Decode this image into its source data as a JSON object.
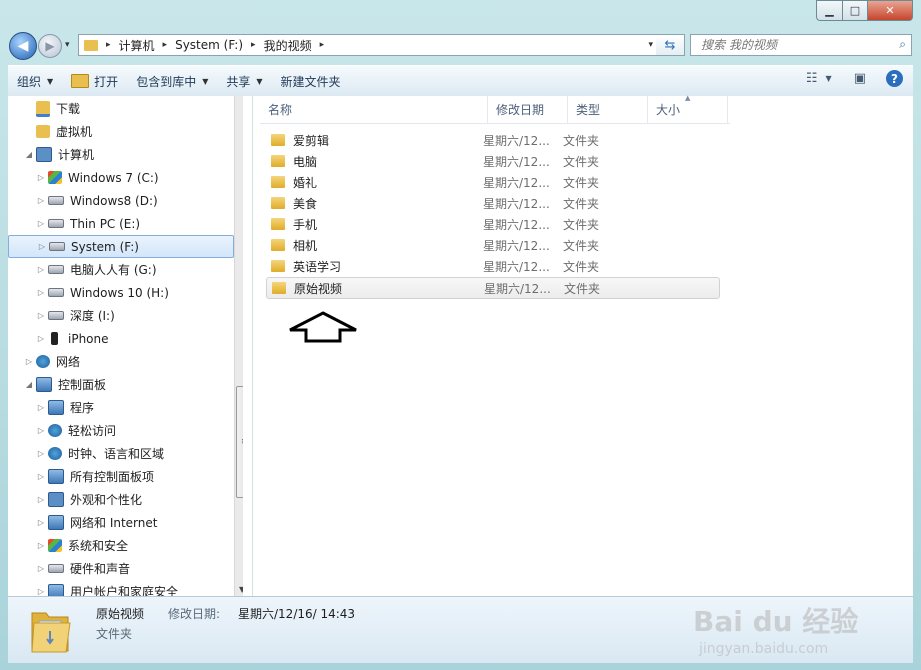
{
  "window": {
    "minimize_symbol": "▁",
    "maximize_symbol": "□",
    "close_symbol": "✕"
  },
  "navigation": {
    "back_symbol": "◀",
    "forward_symbol": "▶",
    "dropdown_symbol": "▾",
    "breadcrumbs": [
      "计算机",
      "System (F:)",
      "我的视频"
    ],
    "refresh_symbol": "⇆"
  },
  "search": {
    "placeholder": "搜索 我的视频"
  },
  "toolbar": {
    "organize": "组织",
    "open": "打开",
    "include_in_library": "包含到库中",
    "share": "共享",
    "new_folder": "新建文件夹",
    "help": "?"
  },
  "tree": {
    "items": [
      {
        "label": "下载",
        "icon": "download-folder-icon"
      },
      {
        "label": "虚拟机",
        "icon": "folder-icon"
      },
      {
        "label": "计算机",
        "icon": "computer-icon"
      },
      {
        "label": "Windows 7  (C:)",
        "icon": "windows-drive-icon"
      },
      {
        "label": "Windows8 (D:)",
        "icon": "drive-icon"
      },
      {
        "label": "Thin PC (E:)",
        "icon": "drive-icon"
      },
      {
        "label": "System (F:)",
        "icon": "drive-icon"
      },
      {
        "label": "电脑人人有 (G:)",
        "icon": "drive-icon"
      },
      {
        "label": "Windows 10 (H:)",
        "icon": "drive-icon"
      },
      {
        "label": "深度 (I:)",
        "icon": "drive-icon"
      },
      {
        "label": "iPhone",
        "icon": "phone-icon"
      },
      {
        "label": "网络",
        "icon": "network-icon"
      },
      {
        "label": "控制面板",
        "icon": "control-panel-icon"
      },
      {
        "label": "程序",
        "icon": "programs-icon"
      },
      {
        "label": "轻松访问",
        "icon": "accessibility-icon"
      },
      {
        "label": "时钟、语言和区域",
        "icon": "clock-language-icon"
      },
      {
        "label": "所有控制面板项",
        "icon": "control-panel-icon"
      },
      {
        "label": "外观和个性化",
        "icon": "appearance-icon"
      },
      {
        "label": "网络和 Internet",
        "icon": "network-internet-icon"
      },
      {
        "label": "系统和安全",
        "icon": "security-icon"
      },
      {
        "label": "硬件和声音",
        "icon": "hardware-icon"
      },
      {
        "label": "用户帐户和家庭安全",
        "icon": "user-accounts-icon"
      }
    ],
    "selected": "System (F:)"
  },
  "file_list": {
    "columns": [
      "名称",
      "修改日期",
      "类型",
      "大小"
    ],
    "rows": [
      {
        "name": "爱剪辑",
        "date": "星期六/12...",
        "type": "文件夹"
      },
      {
        "name": "电脑",
        "date": "星期六/12...",
        "type": "文件夹"
      },
      {
        "name": "婚礼",
        "date": "星期六/12...",
        "type": "文件夹"
      },
      {
        "name": "美食",
        "date": "星期六/12...",
        "type": "文件夹"
      },
      {
        "name": "手机",
        "date": "星期六/12...",
        "type": "文件夹"
      },
      {
        "name": "相机",
        "date": "星期六/12...",
        "type": "文件夹"
      },
      {
        "name": "英语学习",
        "date": "星期六/12...",
        "type": "文件夹"
      },
      {
        "name": "原始视频",
        "date": "星期六/12...",
        "type": "文件夹"
      }
    ],
    "selected": "原始视频"
  },
  "details": {
    "name": "原始视频",
    "modified_label": "修改日期:",
    "modified_value": "星期六/12/16/ 14:43",
    "type": "文件夹"
  },
  "watermark": {
    "brand": "Bai du 经验",
    "url": "jingyan.baidu.com"
  },
  "colors": {
    "frame": "#bfe0e6",
    "selection_border": "#84acdd",
    "folder": "#e9c04f",
    "close_button": "#c6452d"
  }
}
